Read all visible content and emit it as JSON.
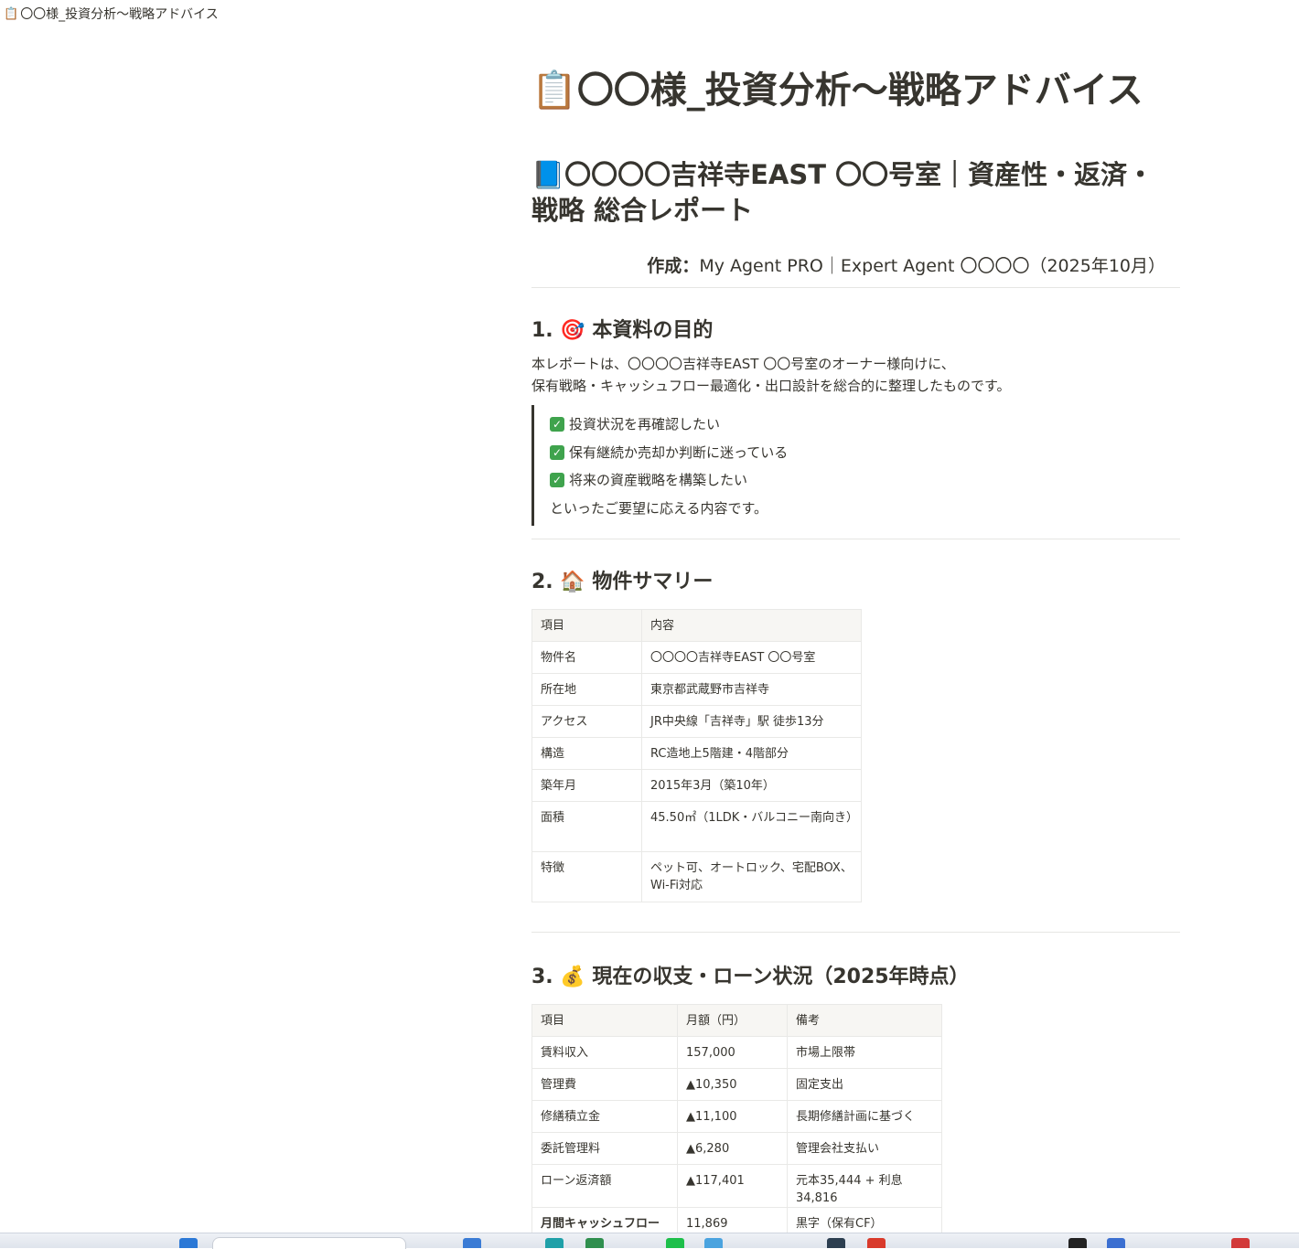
{
  "tab": {
    "icon": "clipboard-icon",
    "title": "〇〇様_投資分析〜戦略アドバイス"
  },
  "page": {
    "icon": "clipboard-icon",
    "title": "〇〇様_投資分析〜戦略アドバイス",
    "report_icon": "blue-book-icon",
    "report_title": "〇〇〇〇吉祥寺EAST 〇〇号室｜資産性・返済・戦略 総合レポート",
    "author_label": "作成：",
    "author_value": "My Agent PRO｜Expert Agent 〇〇〇〇（2025年10月）"
  },
  "section1": {
    "number": "1.",
    "icon": "target-icon",
    "title": "本資料の目的",
    "para_line1": "本レポートは、〇〇〇〇吉祥寺EAST 〇〇号室のオーナー様向けに、",
    "para_line2": "保有戦略・キャッシュフロー最適化・出口設計を総合的に整理したものです。",
    "checklist": [
      "投資状況を再確認したい",
      "保有継続か売却か判断に迷っている",
      "将来の資産戦略を構築したい"
    ],
    "quote_closing": "といったご要望に応える内容です。"
  },
  "section2": {
    "number": "2.",
    "icon": "house-icon",
    "title": "物件サマリー",
    "headers": [
      "項目",
      "内容"
    ],
    "rows": [
      [
        "物件名",
        "〇〇〇〇吉祥寺EAST 〇〇号室"
      ],
      [
        "所在地",
        "東京都武蔵野市吉祥寺"
      ],
      [
        "アクセス",
        "JR中央線「吉祥寺」駅 徒歩13分"
      ],
      [
        "構造",
        "RC造地上5階建・4階部分"
      ],
      [
        "築年月",
        "2015年3月（築10年）"
      ],
      [
        "面積",
        "45.50㎡（1LDK・バルコニー南向き）"
      ],
      [
        "特徴",
        "ペット可、オートロック、宅配BOX、Wi-Fi対応"
      ]
    ]
  },
  "section3": {
    "number": "3.",
    "icon": "money-bag-icon",
    "title": "現在の収支・ローン状況（2025年時点）",
    "headers": [
      "項目",
      "月額（円）",
      "備考"
    ],
    "rows": [
      [
        "賃料収入",
        "157,000",
        "市場上限帯"
      ],
      [
        "管理費",
        "▲10,350",
        "固定支出"
      ],
      [
        "修繕積立金",
        "▲11,100",
        "長期修繕計画に基づく"
      ],
      [
        "委託管理料",
        "▲6,280",
        "管理会社支払い"
      ],
      [
        "ローン返済額",
        "▲117,401",
        "元本35,444 + 利息34,816"
      ],
      [
        "月間キャッシュフロー",
        "11,869",
        "黒字（保有CF）"
      ]
    ]
  }
}
